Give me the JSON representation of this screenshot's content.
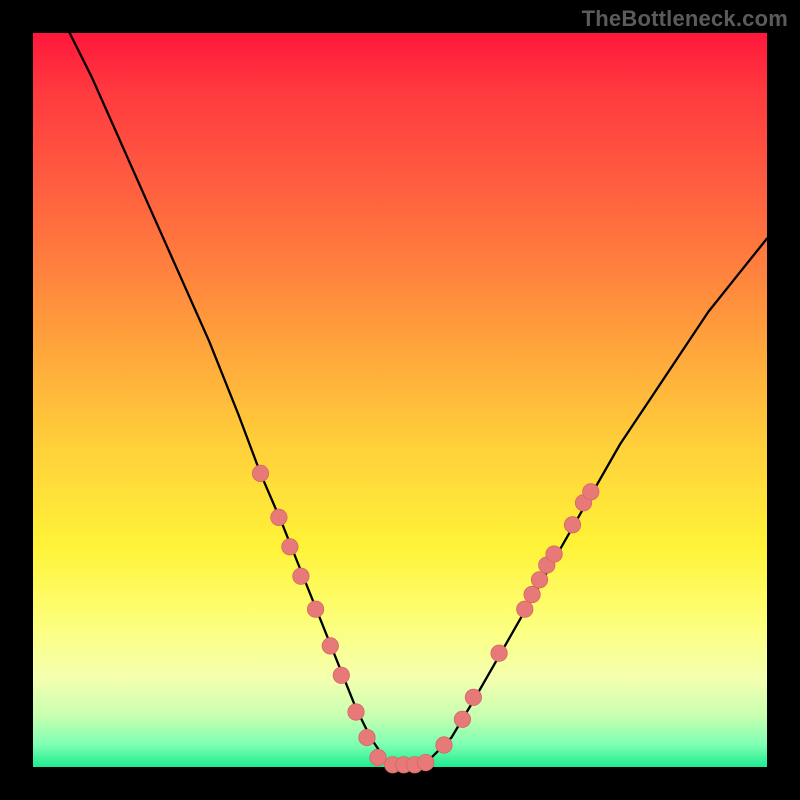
{
  "watermark": "TheBottleneck.com",
  "colors": {
    "curve": "#000000",
    "marker_fill": "#e77a78",
    "marker_stroke": "#d46662",
    "panel_border": "#000000"
  },
  "chart_data": {
    "type": "line",
    "title": "",
    "xlabel": "",
    "ylabel": "",
    "xlim": [
      0,
      100
    ],
    "ylim": [
      0,
      100
    ],
    "series": [
      {
        "name": "bottleneck-curve",
        "x": [
          5,
          8,
          12,
          16,
          20,
          24,
          28,
          31,
          34,
          36,
          38,
          40,
          42,
          44,
          46,
          48,
          50,
          52,
          54,
          57,
          60,
          64,
          68,
          72,
          76,
          80,
          84,
          88,
          92,
          96,
          100
        ],
        "y": [
          100,
          94,
          85,
          76,
          67,
          58,
          48,
          40,
          33,
          28,
          23,
          18,
          13,
          8,
          4,
          1,
          0.3,
          0.3,
          1,
          4,
          9,
          16,
          23,
          30,
          37,
          44,
          50,
          56,
          62,
          67,
          72
        ]
      }
    ],
    "markers": {
      "name": "sample-points",
      "points": [
        {
          "x": 31,
          "y": 40
        },
        {
          "x": 33.5,
          "y": 34
        },
        {
          "x": 35,
          "y": 30
        },
        {
          "x": 36.5,
          "y": 26
        },
        {
          "x": 38.5,
          "y": 21.5
        },
        {
          "x": 40.5,
          "y": 16.5
        },
        {
          "x": 42,
          "y": 12.5
        },
        {
          "x": 44,
          "y": 7.5
        },
        {
          "x": 45.5,
          "y": 4
        },
        {
          "x": 47,
          "y": 1.3
        },
        {
          "x": 49,
          "y": 0.3
        },
        {
          "x": 50.5,
          "y": 0.3
        },
        {
          "x": 52,
          "y": 0.3
        },
        {
          "x": 53.5,
          "y": 0.6
        },
        {
          "x": 56,
          "y": 3
        },
        {
          "x": 58.5,
          "y": 6.5
        },
        {
          "x": 60,
          "y": 9.5
        },
        {
          "x": 63.5,
          "y": 15.5
        },
        {
          "x": 67,
          "y": 21.5
        },
        {
          "x": 68,
          "y": 23.5
        },
        {
          "x": 69,
          "y": 25.5
        },
        {
          "x": 70,
          "y": 27.5
        },
        {
          "x": 71,
          "y": 29
        },
        {
          "x": 73.5,
          "y": 33
        },
        {
          "x": 75,
          "y": 36
        },
        {
          "x": 76,
          "y": 37.5
        }
      ]
    }
  }
}
